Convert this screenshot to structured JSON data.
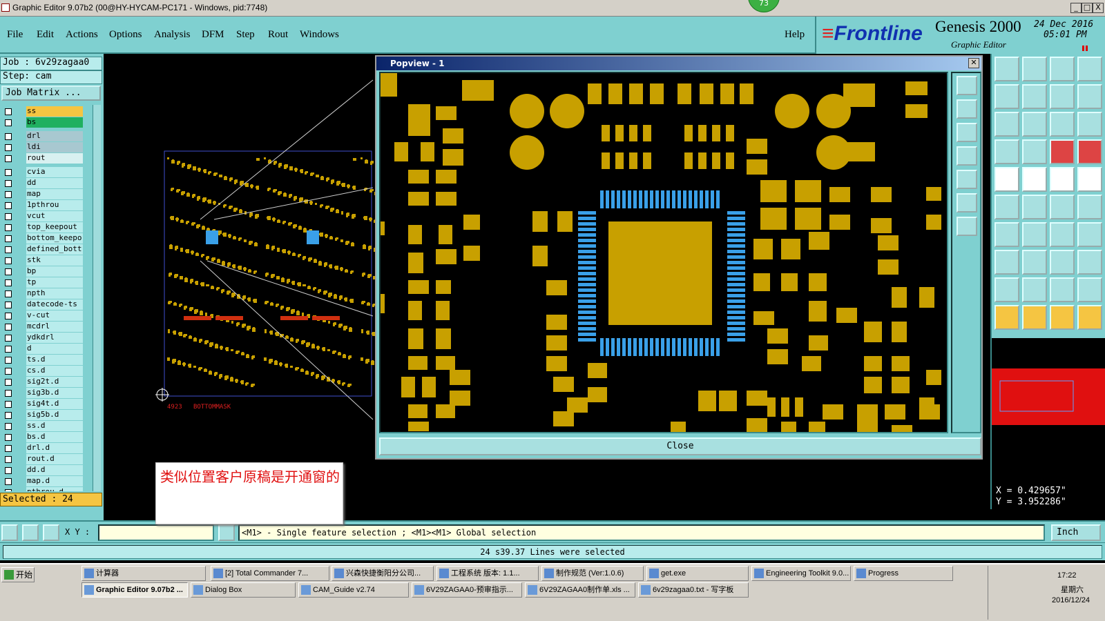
{
  "window": {
    "title": "Graphic Editor 9.07b2 (00@HY-HYCAM-PC171 - Windows, pid:7748)",
    "badge": "73",
    "controls": [
      "_",
      "□",
      "X"
    ]
  },
  "menu": {
    "items": [
      "File",
      "Edit",
      "Actions",
      "Options",
      "Analysis",
      "DFM",
      "Step",
      "Rout",
      "Windows"
    ],
    "help": "Help"
  },
  "brand": {
    "logo": "Frontline",
    "product": "Genesis 2000",
    "subtitle": "Graphic Editor",
    "date": "24 Dec 2016",
    "time": "05:01 PM"
  },
  "job": {
    "job_line": "Job : 6v29zagaa0",
    "step_line": "Step: cam",
    "job_matrix": "Job Matrix ...",
    "selected": "Selected : 24"
  },
  "layers": [
    {
      "name": "ss",
      "style": "yellow"
    },
    {
      "name": "bs",
      "style": "green"
    },
    {
      "name": "drl",
      "style": "gray"
    },
    {
      "name": "ldi",
      "style": "gray"
    },
    {
      "name": "rout",
      "style": "light"
    },
    {
      "name": "cvia",
      "style": ""
    },
    {
      "name": "dd",
      "style": ""
    },
    {
      "name": "map",
      "style": ""
    },
    {
      "name": "1pthrou",
      "style": ""
    },
    {
      "name": "vcut",
      "style": ""
    },
    {
      "name": "top_keepout",
      "style": ""
    },
    {
      "name": "bottom_keepo",
      "style": ""
    },
    {
      "name": "defined_bott",
      "style": ""
    },
    {
      "name": "stk",
      "style": ""
    },
    {
      "name": "bp",
      "style": ""
    },
    {
      "name": "tp",
      "style": ""
    },
    {
      "name": "npth",
      "style": ""
    },
    {
      "name": "datecode-ts",
      "style": ""
    },
    {
      "name": "v-cut",
      "style": ""
    },
    {
      "name": "mcdrl",
      "style": ""
    },
    {
      "name": "ydkdrl",
      "style": ""
    },
    {
      "name": "d",
      "style": ""
    },
    {
      "name": "ts.d",
      "style": ""
    },
    {
      "name": "cs.d",
      "style": ""
    },
    {
      "name": "sig2t.d",
      "style": ""
    },
    {
      "name": "sig3b.d",
      "style": ""
    },
    {
      "name": "sig4t.d",
      "style": ""
    },
    {
      "name": "sig5b.d",
      "style": ""
    },
    {
      "name": "ss.d",
      "style": ""
    },
    {
      "name": "bs.d",
      "style": ""
    },
    {
      "name": "drl.d",
      "style": ""
    },
    {
      "name": "rout.d",
      "style": ""
    },
    {
      "name": "dd.d",
      "style": ""
    },
    {
      "name": "map.d",
      "style": ""
    },
    {
      "name": "pthrou.d",
      "style": ""
    }
  ],
  "canvas": {
    "label_num": "4923",
    "label_layer": "BOTTOMMASK"
  },
  "popview": {
    "title": "Popview - 1",
    "close_label": "Close",
    "pad_color": "#c8a000",
    "ic_pad_color": "#3aa0e8"
  },
  "coords": {
    "x": "X = 0.429657\"",
    "y": "Y = 3.952286\""
  },
  "command": {
    "xy_label": "X Y :",
    "message": "<M1> - Single feature selection ; <M1><M1> Global selection",
    "unit": "Inch"
  },
  "status": {
    "text": "24 s39.37 Lines were selected"
  },
  "note": {
    "text": "类似位置客户原稿是开通窗的"
  },
  "taskbar": {
    "start": "开始",
    "row1": [
      "计算器",
      "[2] Total Commander 7...",
      "兴森快捷衡阳分公司...",
      "工程系统  版本: 1.1...",
      "制作规范 (Ver:1.0.6)",
      "get.exe",
      "Engineering Toolkit 9.0...",
      "Progress"
    ],
    "row2": [
      "Graphic Editor 9.07b2 ...",
      "Dialog Box",
      "CAM_Guide v2.74",
      "6V29ZAGAA0-预审指示...",
      "6V29ZAGAA0制作单.xls ...",
      "6v29zagaa0.txt - 写字板"
    ],
    "time": "17:22",
    "weekday": "星期六",
    "date": "2016/12/24"
  }
}
